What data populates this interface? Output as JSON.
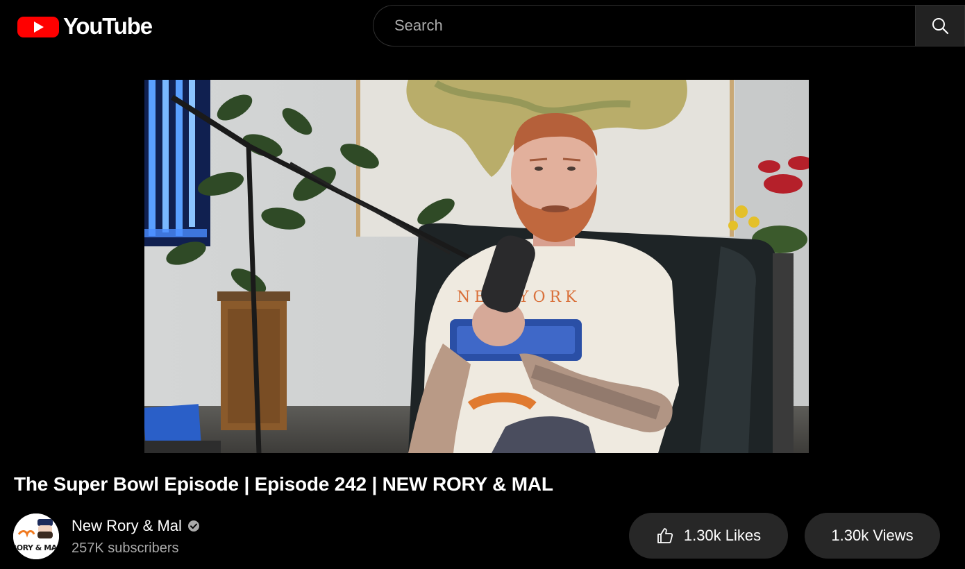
{
  "header": {
    "logo_text": "YouTube",
    "search_placeholder": "Search"
  },
  "video": {
    "title": "The Super Bowl Episode | Episode 242 | NEW RORY & MAL"
  },
  "channel": {
    "name": "New Rory & Mal",
    "subscribers": "257K subscribers",
    "avatar_text": "RORY & MAL"
  },
  "actions": {
    "likes_label": "1.30k Likes",
    "views_label": "1.30k Views"
  },
  "colors": {
    "background": "#000000",
    "brand_red": "#ff0000",
    "pill_bg": "#272727",
    "secondary_text": "#aaaaaa"
  }
}
